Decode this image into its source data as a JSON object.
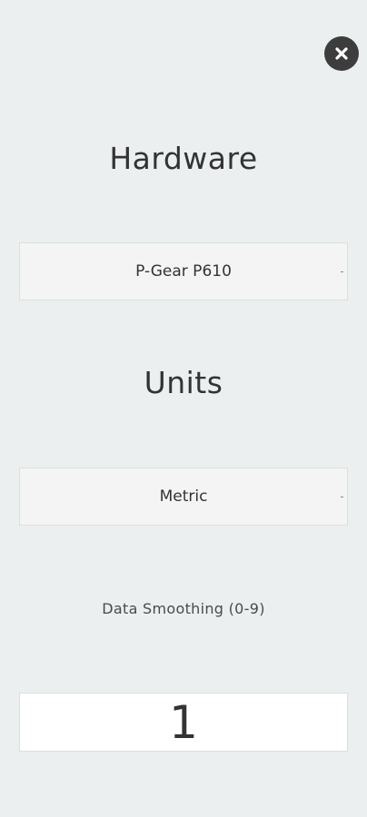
{
  "close": {
    "icon": "close-icon"
  },
  "hardware": {
    "heading": "Hardware",
    "selected": "P-Gear P610"
  },
  "units": {
    "heading": "Units",
    "selected": "Metric"
  },
  "smoothing": {
    "label": "Data Smoothing (0-9)",
    "value": "1"
  },
  "colors": {
    "background": "#ebeff0",
    "close_button": "#3d3d3d",
    "text": "#333333"
  }
}
